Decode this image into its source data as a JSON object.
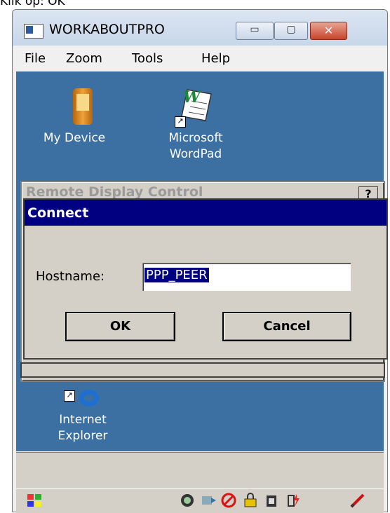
{
  "caption": "Klik op: OK",
  "window": {
    "title": "WORKABOUTPRO",
    "buttons": {
      "minimize": "▭",
      "maximize": "▢",
      "close": "✕"
    }
  },
  "menu": [
    "File",
    "Zoom",
    "Tools",
    "Help"
  ],
  "desktop_icons": {
    "my_device": [
      "My Device"
    ],
    "wordpad": [
      "Microsoft",
      "WordPad"
    ],
    "ie": [
      "Internet",
      "Explorer"
    ]
  },
  "remote_display": {
    "title": "Remote Display Control",
    "help": "?"
  },
  "connect_dialog": {
    "title": "Connect",
    "hostname_label": "Hostname:",
    "hostname_value": "PPP_PEER",
    "ok": "OK",
    "cancel": "Cancel"
  },
  "taskbar": {
    "start_icon": "windows-flag-icon",
    "tray_icons": [
      "network-globe-icon",
      "sync-icon",
      "connection-blocked-icon",
      "lock-icon",
      "battery-icon",
      "power-icon",
      "pen-icon"
    ]
  },
  "colors": {
    "desktop": "#3c6fa2",
    "dialog_title": "#000080",
    "selection": "#000080"
  }
}
